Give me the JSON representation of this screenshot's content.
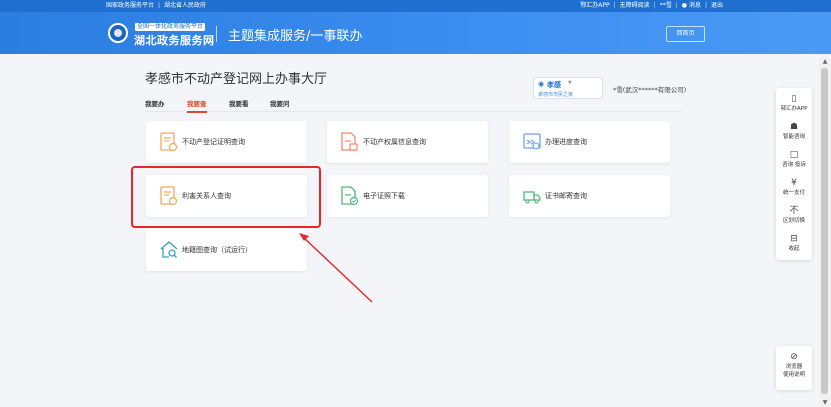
{
  "topbar": {
    "national": "国家政务服务平台",
    "provincial": "湖北省人民政府",
    "app": "鄂汇办APP",
    "accessible": "无障碍阅读",
    "user": "**雪",
    "messages": "消息",
    "logout": "退出"
  },
  "header": {
    "logo_sub": "全国一体化政务服务平台",
    "logo_main": "湖北政务服务网",
    "title": "主题集成服务/一事联办",
    "home_button": "回首页"
  },
  "page": {
    "title": "孝感市不动产登记网上办事大厅",
    "tabs": [
      "我要办",
      "我要查",
      "我要看",
      "我要问"
    ],
    "active_tab": 1,
    "region": {
      "name": "孝感",
      "switch": "孝感市市民之家"
    },
    "company": "*雪(武汉******有限公司)"
  },
  "cards": [
    "不动产登记证明查询",
    "不动产权属信息查询",
    "办理进度查询",
    "利害关系人查询",
    "电子证照下载",
    "证书邮寄查询",
    "地籍图查询（试运行）"
  ],
  "side_panel": {
    "items": [
      "鄂汇办APP",
      "智能咨询",
      "咨询 投诉",
      "统一支付",
      "区划切换",
      "收起"
    ],
    "bottom": [
      "浏览器",
      "使用说明"
    ]
  },
  "colors": {
    "brand_blue": "#1f6fd0",
    "active_tab": "#e0462c",
    "highlight": "#e8262a",
    "icon_orange": "#f0a95a",
    "icon_green": "#4fb97a"
  }
}
